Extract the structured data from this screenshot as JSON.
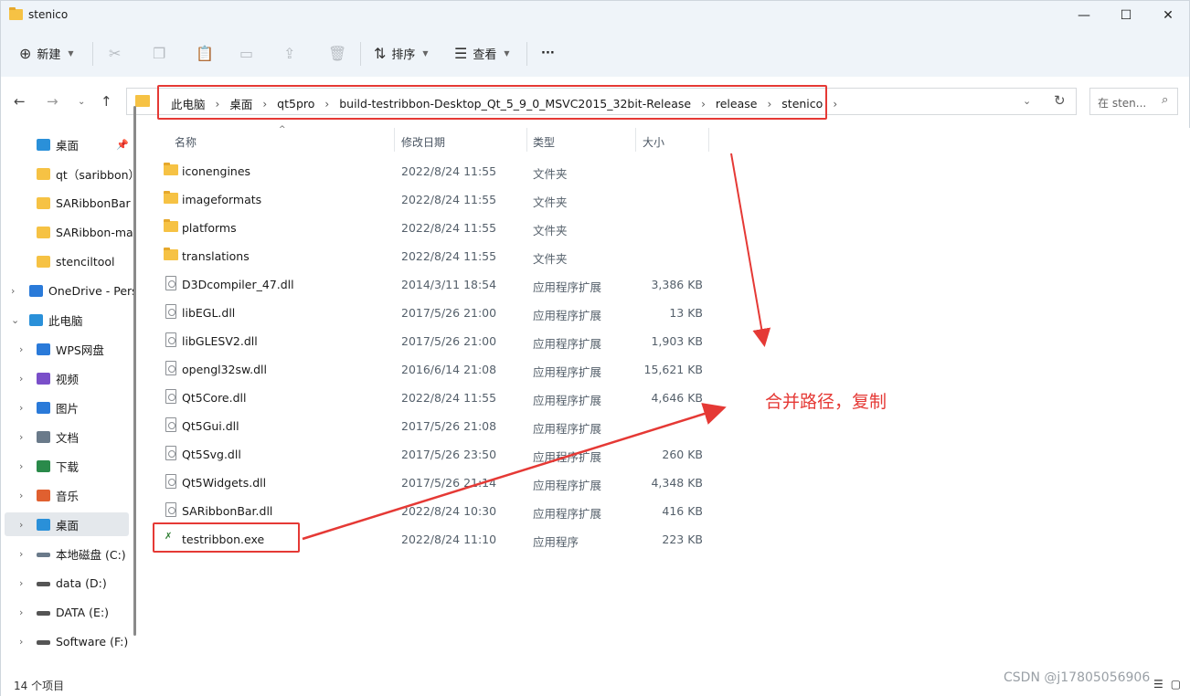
{
  "window": {
    "title": "stenico",
    "min": "—",
    "max": "☐",
    "close": "✕"
  },
  "toolbar": {
    "new_label": "新建",
    "sort_label": "排序",
    "view_label": "查看",
    "more_label": "···"
  },
  "address": {
    "crumbs": [
      "此电脑",
      "桌面",
      "qt5pro",
      "build-testribbon-Desktop_Qt_5_9_0_MSVC2015_32bit-Release",
      "release",
      "stenico"
    ]
  },
  "search": {
    "placeholder": "在 sten..."
  },
  "sidebar": {
    "items": [
      {
        "label": "桌面",
        "indent": 2
      },
      {
        "label": "qt（saribbon）",
        "indent": 2
      },
      {
        "label": "SARibbonBar",
        "indent": 2
      },
      {
        "label": "SARibbon-ma",
        "indent": 2
      },
      {
        "label": "stenciltool",
        "indent": 2
      },
      {
        "label": "OneDrive - Pers",
        "indent": 1
      },
      {
        "label": "此电脑",
        "indent": 1
      },
      {
        "label": "WPS网盘",
        "indent": 2
      },
      {
        "label": "视频",
        "indent": 2
      },
      {
        "label": "图片",
        "indent": 2
      },
      {
        "label": "文档",
        "indent": 2
      },
      {
        "label": "下载",
        "indent": 2
      },
      {
        "label": "音乐",
        "indent": 2
      },
      {
        "label": "桌面",
        "indent": 2
      },
      {
        "label": "本地磁盘 (C:)",
        "indent": 2
      },
      {
        "label": "data (D:)",
        "indent": 2
      },
      {
        "label": "DATA (E:)",
        "indent": 2
      },
      {
        "label": "Software (F:)",
        "indent": 2
      }
    ]
  },
  "columns": {
    "name": "名称",
    "date": "修改日期",
    "type": "类型",
    "size": "大小"
  },
  "files": [
    {
      "name": "iconengines",
      "date": "2022/8/24 11:55",
      "type": "文件夹",
      "size": "",
      "kind": "folder"
    },
    {
      "name": "imageformats",
      "date": "2022/8/24 11:55",
      "type": "文件夹",
      "size": "",
      "kind": "folder"
    },
    {
      "name": "platforms",
      "date": "2022/8/24 11:55",
      "type": "文件夹",
      "size": "",
      "kind": "folder"
    },
    {
      "name": "translations",
      "date": "2022/8/24 11:55",
      "type": "文件夹",
      "size": "",
      "kind": "folder"
    },
    {
      "name": "D3Dcompiler_47.dll",
      "date": "2014/3/11 18:54",
      "type": "应用程序扩展",
      "size": "3,386 KB",
      "kind": "dll"
    },
    {
      "name": "libEGL.dll",
      "date": "2017/5/26 21:00",
      "type": "应用程序扩展",
      "size": "13 KB",
      "kind": "dll"
    },
    {
      "name": "libGLESV2.dll",
      "date": "2017/5/26 21:00",
      "type": "应用程序扩展",
      "size": "1,903 KB",
      "kind": "dll"
    },
    {
      "name": "opengl32sw.dll",
      "date": "2016/6/14 21:08",
      "type": "应用程序扩展",
      "size": "15,621 KB",
      "kind": "dll"
    },
    {
      "name": "Qt5Core.dll",
      "date": "2022/8/24 11:55",
      "type": "应用程序扩展",
      "size": "4,646 KB",
      "kind": "dll"
    },
    {
      "name": "Qt5Gui.dll",
      "date": "2017/5/26 21:08",
      "type": "应用程序扩展",
      "size": "",
      "kind": "dll"
    },
    {
      "name": "Qt5Svg.dll",
      "date": "2017/5/26 23:50",
      "type": "应用程序扩展",
      "size": "260 KB",
      "kind": "dll"
    },
    {
      "name": "Qt5Widgets.dll",
      "date": "2017/5/26 21:14",
      "type": "应用程序扩展",
      "size": "4,348 KB",
      "kind": "dll"
    },
    {
      "name": "SARibbonBar.dll",
      "date": "2022/8/24 10:30",
      "type": "应用程序扩展",
      "size": "416 KB",
      "kind": "dll"
    },
    {
      "name": "testribbon.exe",
      "date": "2022/8/24 11:10",
      "type": "应用程序",
      "size": "223 KB",
      "kind": "exe"
    }
  ],
  "status": {
    "count": "14 个项目"
  },
  "annotation": {
    "text": "合并路径，复制"
  },
  "watermark": "CSDN @j17805056906",
  "colors": {
    "highlight": "#e53935",
    "folder": "#f6c244",
    "chrome": "#eff4f9"
  }
}
